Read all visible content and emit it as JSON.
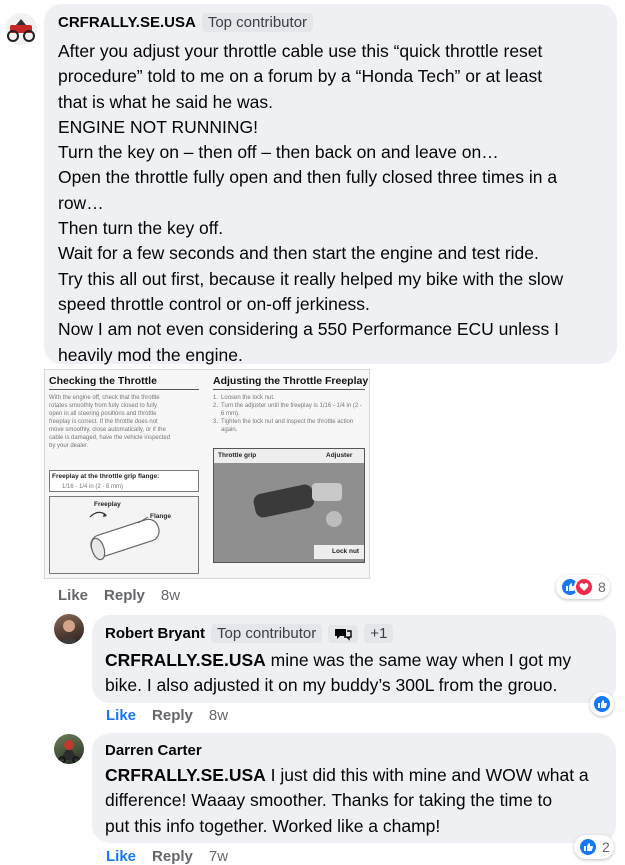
{
  "comment": {
    "author": "CRFRALLY.SE.USA",
    "badge": "Top contributor",
    "lines": [
      "After you adjust your throttle cable use this “quick throttle reset",
      "procedure” told to me on a forum by a “Honda Tech” or at least",
      "that is what he said he was.",
      "ENGINE NOT RUNNING!",
      "Turn the key on – then off – then back on and leave on…",
      "Open the throttle fully open and then fully closed three times in a",
      "row…",
      "Then turn the key off.",
      "Wait for a few seconds and then start the engine and test ride.",
      "Try this all out first, because it really helped my bike with the slow",
      "speed throttle control or on-off jerkiness.",
      "Now I am not even considering a 550 Performance ECU unless I",
      "heavily mod the engine."
    ],
    "actions": {
      "like": "Like",
      "reply": "Reply",
      "time": "8w"
    },
    "reactions": {
      "count": "8",
      "icons": [
        "like-icon",
        "love-icon"
      ]
    }
  },
  "manual_image": {
    "left_title": "Checking the Throttle",
    "left_text": [
      "With the engine off, check that the throttle",
      "rotates smoothly from fully closed to fully",
      "open in all steering positions and throttle",
      "freeplay is correct. If the throttle does not",
      "move smoothly, close automatically, or if the",
      "cable is damaged, have the vehicle inspected",
      "by your dealer."
    ],
    "freeplay_box_title": "Freeplay at the throttle grip flange:",
    "freeplay_box_value": "1/16 - 1/4 in (2 - 6 mm)",
    "diagram_labels": {
      "freeplay": "Freeplay",
      "flange": "Flange"
    },
    "right_title": "Adjusting the Throttle Freeplay",
    "steps": [
      {
        "num": "1.",
        "text": "Loosen the lock nut."
      },
      {
        "num": "2.",
        "text": "Turn the adjuster until the freeplay is 1/16 - 1/4 in (2 - 6 mm)."
      },
      {
        "num": "3.",
        "text": "Tighten the lock nut and inspect the throttle action again."
      }
    ],
    "photo_labels": {
      "grip": "Throttle grip",
      "adjuster": "Adjuster",
      "lock_nut": "Lock nut"
    }
  },
  "replies": [
    {
      "author": "Robert Bryant",
      "badge": "Top contributor",
      "extra_badge": "+1",
      "mention": "CRFRALLY.SE.USA",
      "lines": [
        " mine was the same way when I got my",
        "bike. I also adjusted it on my buddy’s 300L from the grouo."
      ],
      "actions": {
        "like": "Like",
        "reply": "Reply",
        "time": "8w"
      },
      "reactions": {
        "count": "",
        "icons": [
          "like-icon"
        ]
      }
    },
    {
      "author": "Darren Carter",
      "mention": "CRFRALLY.SE.USA",
      "lines": [
        " I just did this with mine and WOW what a",
        "difference! Waaay smoother. Thanks for taking the time to",
        "put this info together. Worked like a champ!"
      ],
      "actions": {
        "like": "Like",
        "reply": "Reply",
        "time": "7w"
      },
      "reactions": {
        "count": "2",
        "icons": [
          "like-icon"
        ]
      }
    }
  ]
}
